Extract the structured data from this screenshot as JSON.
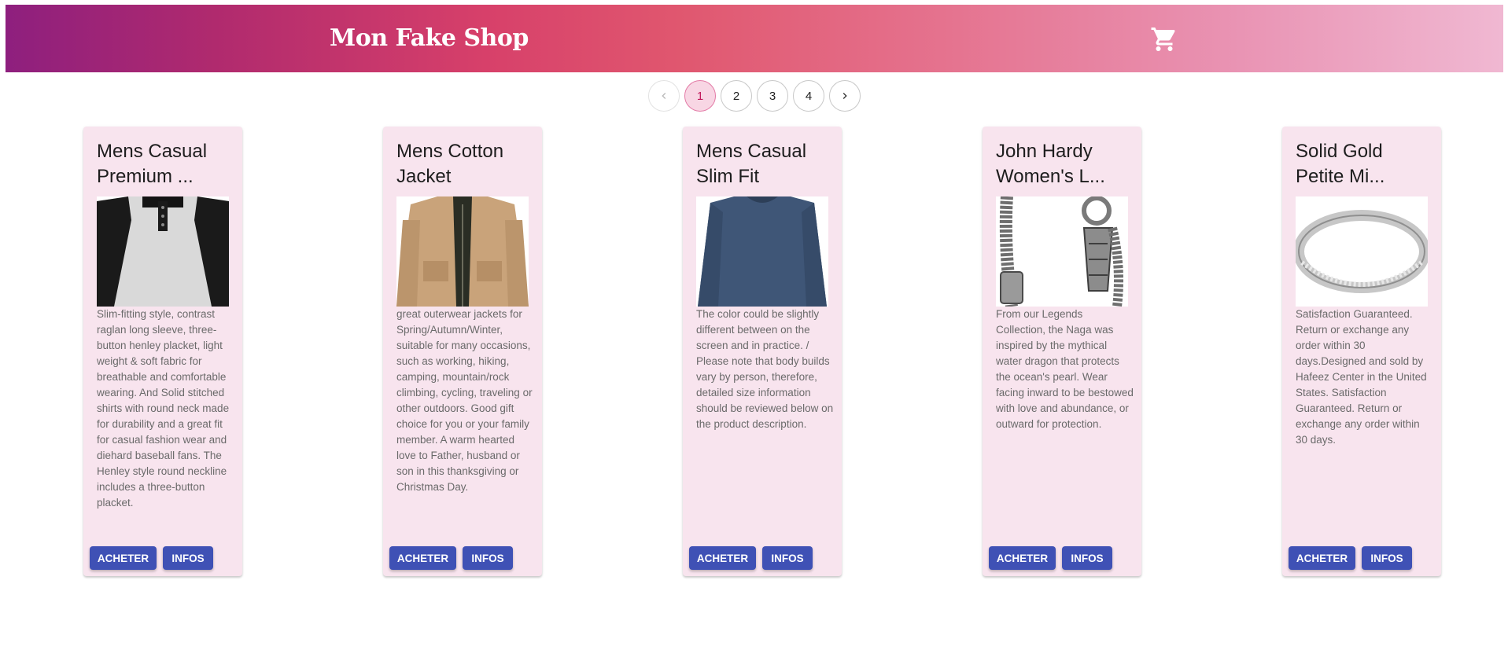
{
  "header": {
    "title": "Mon Fake Shop",
    "cart_icon": "shopping-cart-icon"
  },
  "pagination": {
    "prev_icon": "chevron-left-icon",
    "next_icon": "chevron-right-icon",
    "pages": [
      "1",
      "2",
      "3",
      "4"
    ],
    "current": "1"
  },
  "products": [
    {
      "title": "Mens Casual Premium ...",
      "image": "raglan-henley-shirt",
      "description": "Slim-fitting style, contrast raglan long sleeve, three-button henley placket, light weight & soft fabric for breathable and comfortable wearing. And Solid stitched shirts with round neck made for durability and a great fit for casual fashion wear and diehard baseball fans. The Henley style round neckline includes a three-button placket.",
      "buy_label": "ACHETER",
      "info_label": "INFOS"
    },
    {
      "title": "Mens Cotton Jacket",
      "image": "beige-cotton-jacket",
      "description": "great outerwear jackets for Spring/Autumn/Winter, suitable for many occasions, such as working, hiking, camping, mountain/rock climbing, cycling, traveling or other outdoors. Good gift choice for you or your family member. A warm hearted love to Father, husband or son in this thanksgiving or Christmas Day.",
      "buy_label": "ACHETER",
      "info_label": "INFOS"
    },
    {
      "title": "Mens Casual Slim Fit",
      "image": "navy-slim-fit-shirt",
      "description": "The color could be slightly different between on the screen and in practice. / Please note that body builds vary by person, therefore, detailed size information should be reviewed below on the product description.",
      "buy_label": "ACHETER",
      "info_label": "INFOS"
    },
    {
      "title": "John Hardy Women's L...",
      "image": "silver-chain-bracelet",
      "description": "From our Legends Collection, the Naga was inspired by the mythical water dragon that protects the ocean's pearl. Wear facing inward to be bestowed with love and abundance, or outward for protection.",
      "buy_label": "ACHETER",
      "info_label": "INFOS"
    },
    {
      "title": "Solid Gold Petite Mi...",
      "image": "silver-micropave-ring",
      "description": "Satisfaction Guaranteed. Return or exchange any order within 30 days.Designed and sold by Hafeez Center in the United States. Satisfaction Guaranteed. Return or exchange any order within 30 days.",
      "buy_label": "ACHETER",
      "info_label": "INFOS"
    }
  ],
  "colors": {
    "gradient_start": "#8e1f7e",
    "gradient_mid": "#d7406a",
    "gradient_end": "#f0b8d2",
    "card_bg": "#f8e4ee",
    "button": "#3f51b5",
    "page_active_bg": "#f8d6e4",
    "page_active_text": "#c2185b"
  }
}
